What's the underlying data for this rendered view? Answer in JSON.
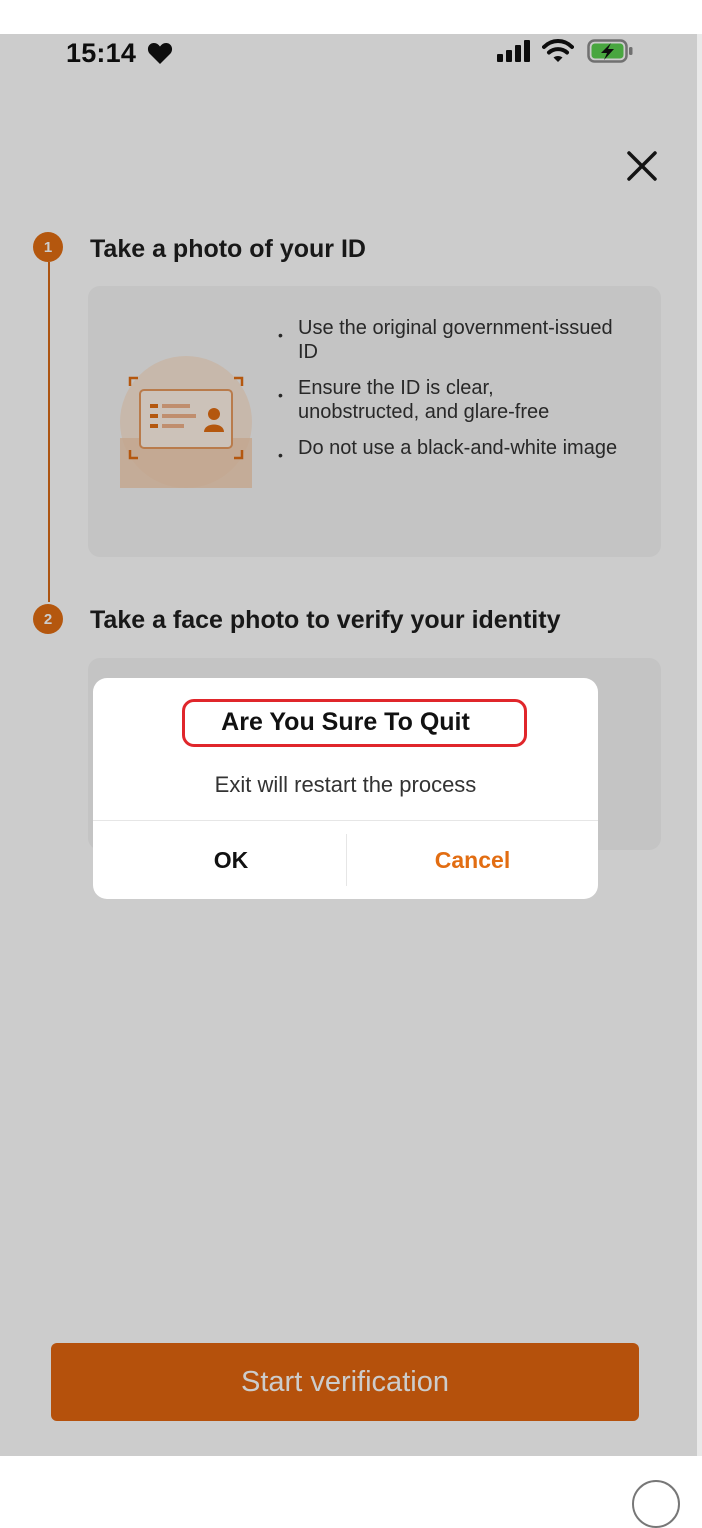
{
  "status_bar": {
    "time": "15:14",
    "icons": [
      "heart-icon",
      "cellular-signal-icon",
      "wifi-icon",
      "battery-charging-icon"
    ]
  },
  "header": {
    "close_icon": "close-icon"
  },
  "steps": [
    {
      "number": "1",
      "title": "Take a photo of your ID",
      "tips": [
        "Use the original government-issued ID",
        "Ensure the ID is clear, unobstructed, and glare-free",
        "Do not use a black-and-white image"
      ]
    },
    {
      "number": "2",
      "title": "Take a face photo to verify your identity"
    }
  ],
  "dialog": {
    "title": "Are You Sure To Quit",
    "message": "Exit will restart the process",
    "ok_label": "OK",
    "cancel_label": "Cancel"
  },
  "footer": {
    "start_label": "Start verification"
  },
  "colors": {
    "accent": "#e26d12",
    "highlight_border": "#e0262b",
    "dim_overlay": "rgba(0,0,0,0.2)"
  }
}
